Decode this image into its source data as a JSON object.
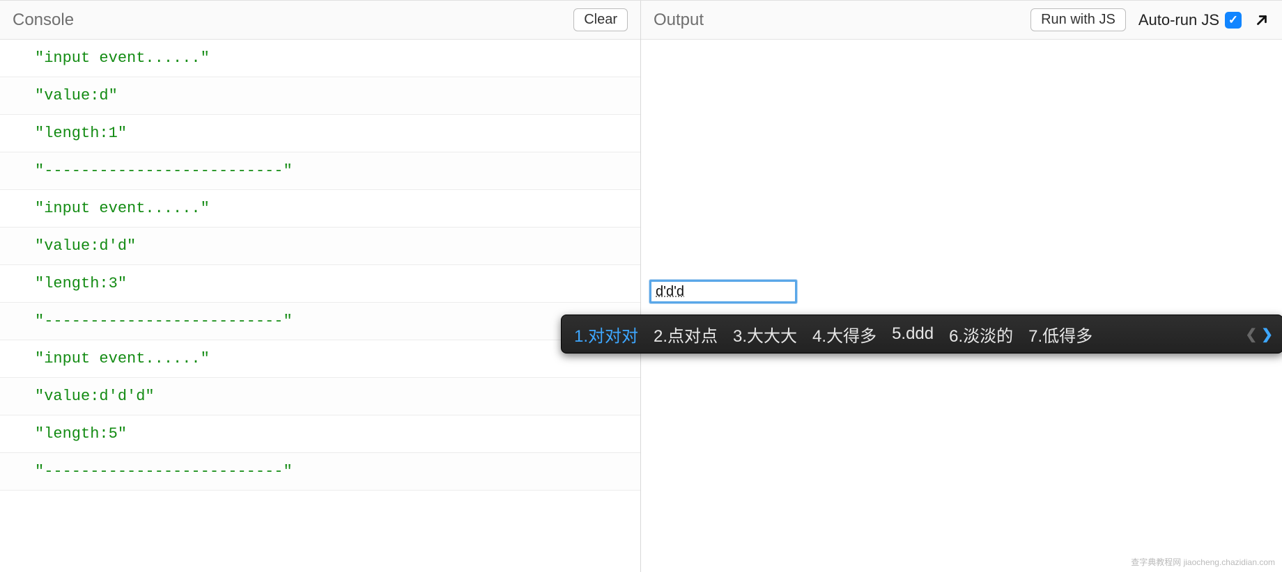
{
  "console": {
    "title": "Console",
    "clear_label": "Clear",
    "logs": [
      "\"input event......\"",
      "\"value:d\"",
      "\"length:1\"",
      "\"--------------------------\"",
      "\"input event......\"",
      "\"value:d'd\"",
      "\"length:3\"",
      "\"--------------------------\"",
      "\"input event......\"",
      "\"value:d'd'd\"",
      "\"length:5\"",
      "\"--------------------------\""
    ]
  },
  "output": {
    "title": "Output",
    "run_label": "Run with JS",
    "autorun_label": "Auto-run JS",
    "autorun_checked": true,
    "input_value": "d'd'd"
  },
  "ime": {
    "candidates": [
      {
        "index": "1",
        "text": "对对对",
        "selected": true
      },
      {
        "index": "2",
        "text": "点对点",
        "selected": false
      },
      {
        "index": "3",
        "text": "大大大",
        "selected": false
      },
      {
        "index": "4",
        "text": "大得多",
        "selected": false
      },
      {
        "index": "5",
        "text": "ddd",
        "selected": false
      },
      {
        "index": "6",
        "text": "淡淡的",
        "selected": false
      },
      {
        "index": "7",
        "text": "低得多",
        "selected": false
      }
    ]
  },
  "watermark": "查字典教程网 jiaocheng.chazidian.com"
}
